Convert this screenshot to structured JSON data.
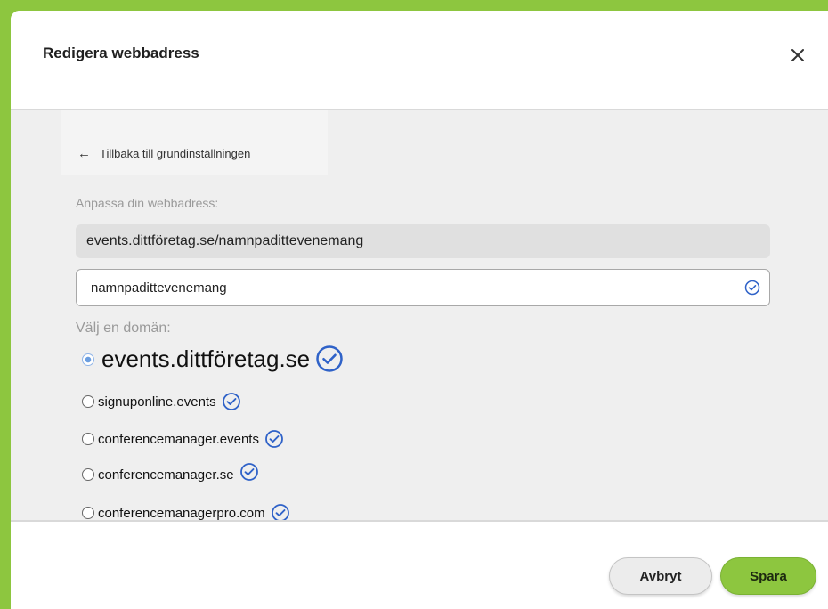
{
  "dialog": {
    "title": "Redigera webbadress"
  },
  "back_link": {
    "label": "Tillbaka till grundinställningen"
  },
  "url": {
    "label": "Anpassa din webbadress:",
    "preview": "events.dittföretag.se/namnpadittevenemang",
    "slug_value": "namnpadittevenemang"
  },
  "domains": {
    "label": "Välj en domän:",
    "options": [
      {
        "label": "events.dittföretag.se",
        "selected": true
      },
      {
        "label": "signuponline.events",
        "selected": false
      },
      {
        "label": "conferencemanager.events",
        "selected": false
      },
      {
        "label": "conferencemanager.se",
        "selected": false
      },
      {
        "label": "conferencemanagerpro.com",
        "selected": false
      }
    ]
  },
  "footer": {
    "cancel_label": "Avbryt",
    "save_label": "Spara"
  },
  "colors": {
    "accent_green": "#8dc63f",
    "check_blue": "#2f62c8",
    "body_gray": "#efefef"
  }
}
